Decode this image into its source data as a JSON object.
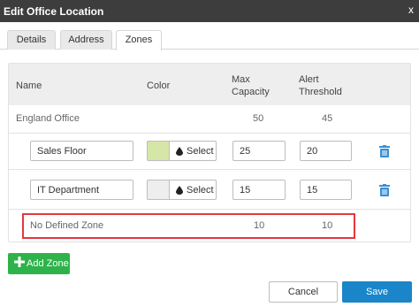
{
  "dialog": {
    "title": "Edit Office Location",
    "close_label": "x"
  },
  "tabs": [
    {
      "label": "Details"
    },
    {
      "label": "Address"
    },
    {
      "label": "Zones",
      "active": true
    }
  ],
  "table": {
    "headers": {
      "name": "Name",
      "color": "Color",
      "max_capacity_line1": "Max",
      "max_capacity_line2": "Capacity",
      "alert_threshold_line1": "Alert",
      "alert_threshold_line2": "Threshold"
    },
    "office": {
      "name": "England Office",
      "max_capacity": "50",
      "alert_threshold": "45"
    },
    "zones": [
      {
        "name": "Sales Floor",
        "color": "#d6e6a6",
        "select_label": "Select",
        "max_capacity": "25",
        "alert_threshold": "20",
        "delete_icon": "trash-icon"
      },
      {
        "name": "IT Department",
        "color": "#eeeeee",
        "select_label": "Select",
        "max_capacity": "15",
        "alert_threshold": "15",
        "delete_icon": "trash-icon"
      }
    ],
    "undefined_zone": {
      "name": "No Defined Zone",
      "max_capacity": "10",
      "alert_threshold": "10",
      "highlight_color": "#e5373c"
    }
  },
  "actions": {
    "add_zone_label": "Add Zone",
    "cancel_label": "Cancel",
    "save_label": "Save"
  },
  "colors": {
    "titlebar": "#3d3d3d",
    "add_zone": "#2db34a",
    "save": "#1a85c8",
    "trash": "#3a8fd4"
  }
}
